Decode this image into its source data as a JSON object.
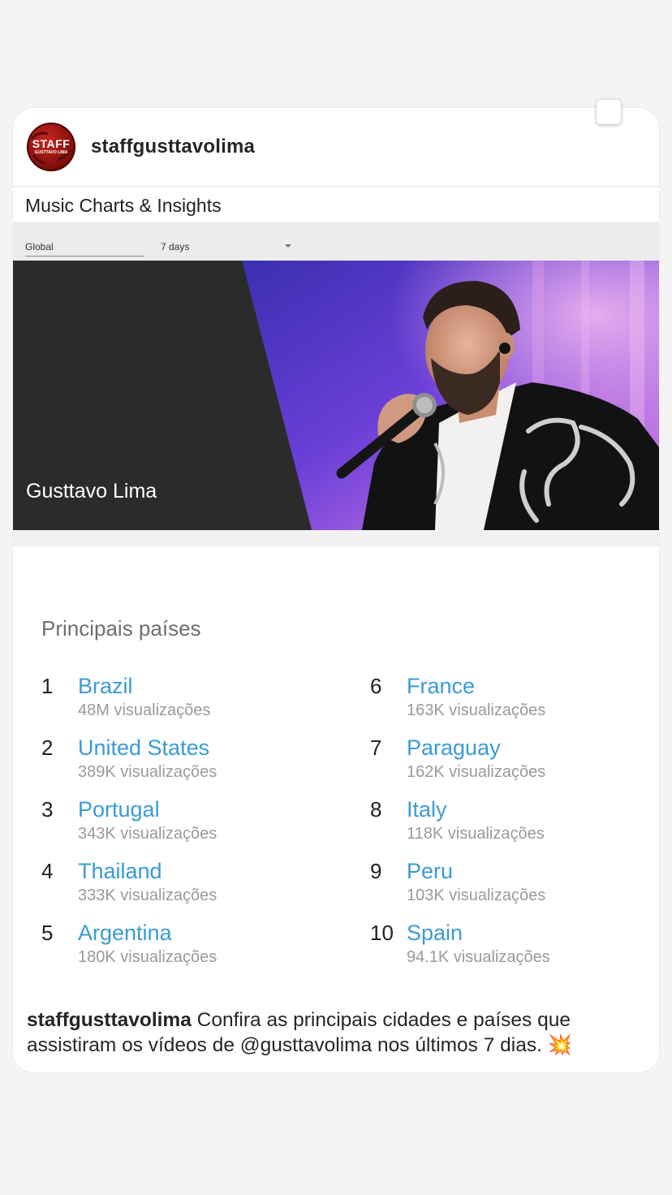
{
  "post": {
    "username": "staffgusttavolima",
    "avatar_text_top": "STAFF",
    "avatar_text_bottom": "GUSTTAVO LIMA",
    "caption_username": "staffgusttavolima",
    "caption_text": "Confira as principais cidades e países que assistiram os vídeos de @gusttavolima nos últimos 7 dias.",
    "caption_emoji": "💥"
  },
  "youtube": {
    "title": "Music Charts & Insights",
    "filter_region": "Global",
    "filter_period": "7 days",
    "artist_name": "Gusttavo Lima"
  },
  "top_countries": {
    "title": "Principais países",
    "items": [
      {
        "rank": "1",
        "name": "Brazil",
        "views": "48M visualizações"
      },
      {
        "rank": "2",
        "name": "United States",
        "views": "389K visualizações"
      },
      {
        "rank": "3",
        "name": "Portugal",
        "views": "343K visualizações"
      },
      {
        "rank": "4",
        "name": "Thailand",
        "views": "333K visualizações"
      },
      {
        "rank": "5",
        "name": "Argentina",
        "views": "180K visualizações"
      },
      {
        "rank": "6",
        "name": "France",
        "views": "163K visualizações"
      },
      {
        "rank": "7",
        "name": "Paraguay",
        "views": "162K visualizações"
      },
      {
        "rank": "8",
        "name": "Italy",
        "views": "118K visualizações"
      },
      {
        "rank": "9",
        "name": "Peru",
        "views": "103K visualizações"
      },
      {
        "rank": "10",
        "name": "Spain",
        "views": "94.1K visualizações"
      }
    ]
  },
  "colors": {
    "link_blue": "#3a9bd6",
    "hero_dark": "#2b2b2b",
    "stage_purple": "#6a3fd8"
  }
}
